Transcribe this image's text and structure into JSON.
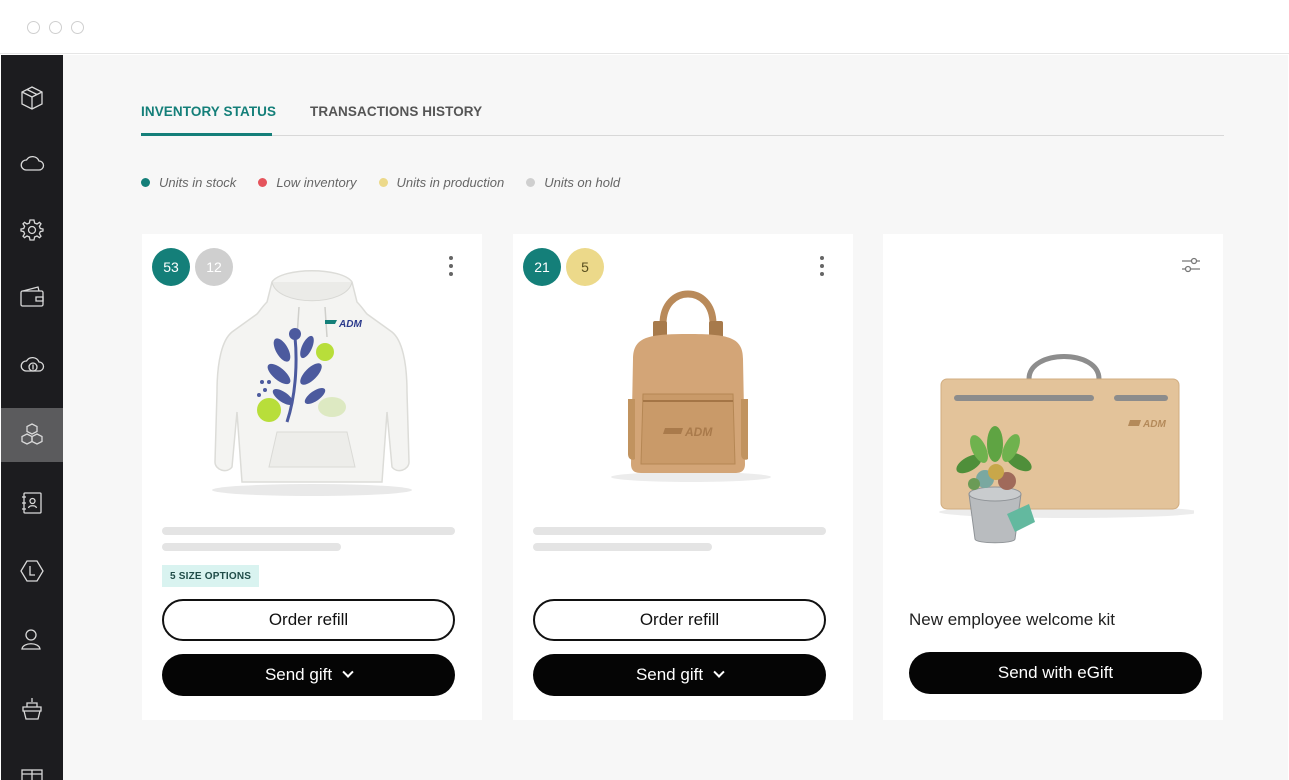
{
  "tabs": {
    "inventory_status": "INVENTORY STATUS",
    "transactions_history": "TRANSACTIONS HISTORY"
  },
  "legend": [
    {
      "label": "Units in stock",
      "color": "#147f79"
    },
    {
      "label": "Low inventory",
      "color": "#e5545c"
    },
    {
      "label": "Units in production",
      "color": "#ecd98a"
    },
    {
      "label": "Units on hold",
      "color": "#cfcfcf"
    }
  ],
  "sidebar": {
    "items": [
      {
        "icon": "box-icon"
      },
      {
        "icon": "cloud-icon"
      },
      {
        "icon": "gear-icon"
      },
      {
        "icon": "wallet-icon"
      },
      {
        "icon": "cloud-dollar-icon"
      },
      {
        "icon": "boxes-icon",
        "active": true
      },
      {
        "icon": "contact-book-icon"
      },
      {
        "icon": "hexagon-logo-icon"
      },
      {
        "icon": "user-icon"
      },
      {
        "icon": "cake-icon"
      },
      {
        "icon": "gift-icon"
      }
    ]
  },
  "cards": [
    {
      "product": "hoodie",
      "badges": [
        {
          "value": "53",
          "color": "#147f79"
        },
        {
          "value": "12",
          "color": "#cfcfcf"
        }
      ],
      "size_options": "5 SIZE OPTIONS",
      "order_refill": "Order refill",
      "send_gift": "Send gift"
    },
    {
      "product": "backpack",
      "badges": [
        {
          "value": "21",
          "color": "#147f79"
        },
        {
          "value": "5",
          "color": "#ecd98a"
        }
      ],
      "order_refill": "Order refill",
      "send_gift": "Send gift"
    },
    {
      "product": "welcome-kit",
      "title": "New employee welcome kit",
      "send_egift": "Send with eGift"
    }
  ],
  "brand": {
    "logo_text": "ADM",
    "accent": "#147f79"
  }
}
